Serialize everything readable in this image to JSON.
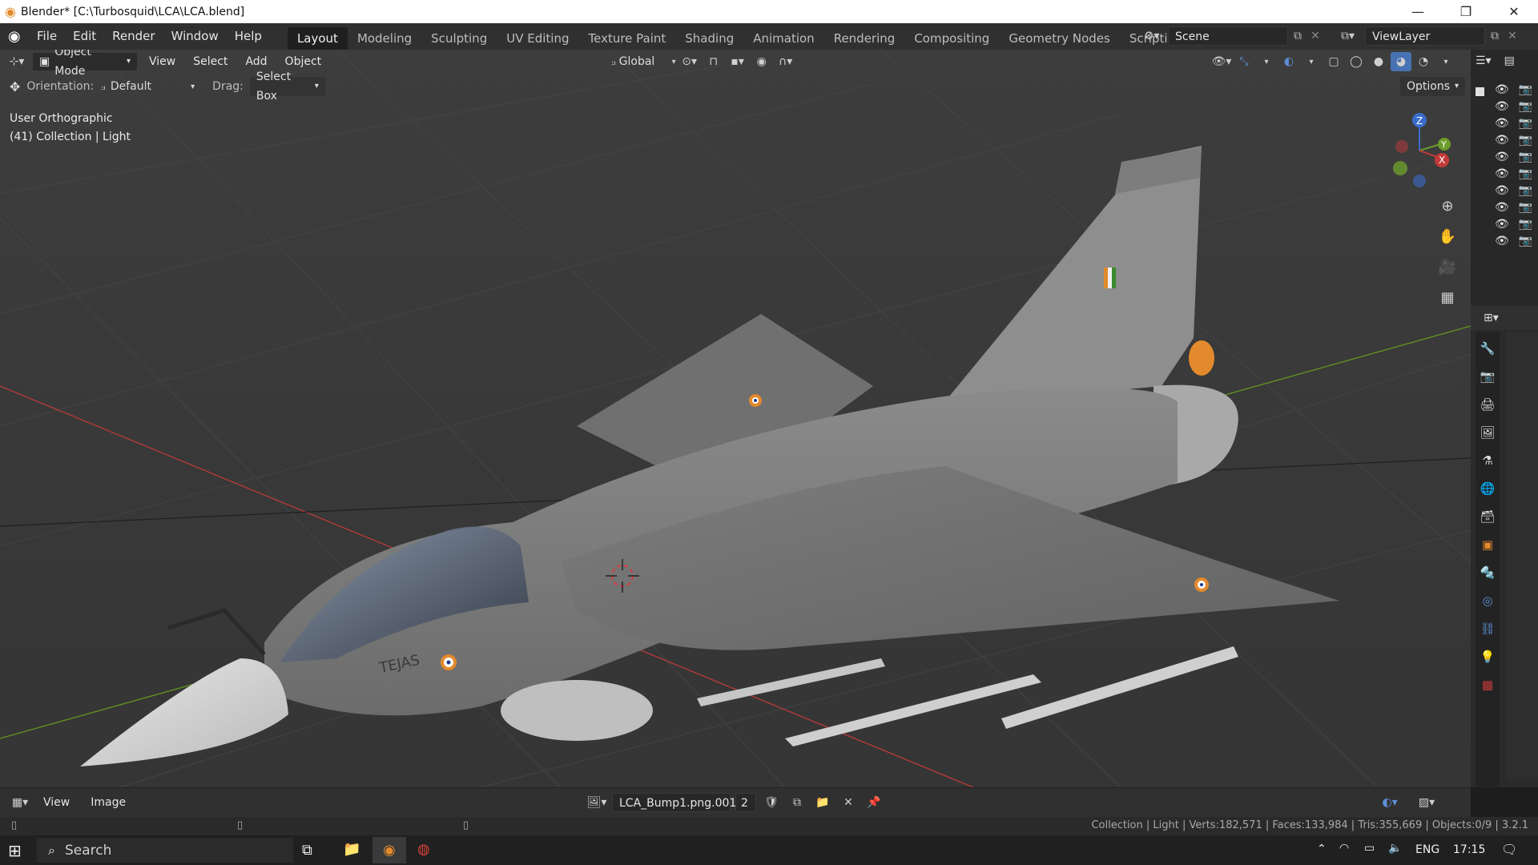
{
  "window": {
    "title": "Blender* [C:\\Turbosquid\\LCA\\LCA.blend]"
  },
  "menu": [
    "File",
    "Edit",
    "Render",
    "Window",
    "Help"
  ],
  "workspaces": [
    "Layout",
    "Modeling",
    "Sculpting",
    "UV Editing",
    "Texture Paint",
    "Shading",
    "Animation",
    "Rendering",
    "Compositing",
    "Geometry Nodes",
    "Scripting"
  ],
  "active_workspace": "Layout",
  "scene": {
    "name": "Scene",
    "view_layer": "ViewLayer"
  },
  "viewport_header": {
    "mode": "Object Mode",
    "menus": [
      "View",
      "Select",
      "Add",
      "Object"
    ],
    "transform_orientation": "Global"
  },
  "tool_settings": {
    "orientation_label": "Orientation:",
    "orientation_value": "Default",
    "drag_label": "Drag:",
    "drag_value": "Select Box",
    "options_label": "Options"
  },
  "viewport_info": {
    "view": "User Orthographic",
    "collection": "(41) Collection | Light"
  },
  "model": {
    "name_on_fuselage": "TEJAS"
  },
  "image_editor": {
    "menus": [
      "View",
      "Image"
    ],
    "image_name": "LCA_Bump1.png.001",
    "users": "2"
  },
  "statusbar": {
    "stats": "Collection | Light | Verts:182,571 | Faces:133,984 | Tris:355,669 | Objects:0/9 | 3.2.1"
  },
  "taskbar": {
    "search": "Search",
    "lang": "ENG",
    "time": "17:15"
  },
  "colors": {
    "accent_blue": "#4772b3",
    "x_axis": "#c23a3a",
    "y_axis": "#6c9c2a",
    "z_axis": "#3a6ccc",
    "orange": "#e38a2c"
  }
}
